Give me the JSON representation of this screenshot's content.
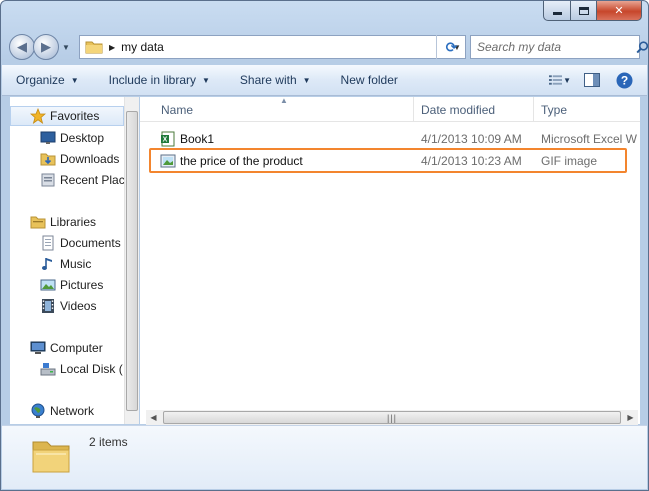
{
  "window": {
    "controls": {
      "minimize": "minimize-icon",
      "maximize": "maximize-icon",
      "close": "close-icon"
    }
  },
  "address": {
    "path": "my data",
    "search_placeholder": "Search my data"
  },
  "toolbar": {
    "organize": "Organize",
    "include_in_library": "Include in library",
    "share_with": "Share with",
    "new_folder": "New folder"
  },
  "nav": {
    "favorites": "Favorites",
    "desktop": "Desktop",
    "downloads": "Downloads",
    "recent_places": "Recent Plac",
    "libraries": "Libraries",
    "documents": "Documents",
    "music": "Music",
    "pictures": "Pictures",
    "videos": "Videos",
    "computer": "Computer",
    "local_disk": "Local Disk (",
    "network": "Network"
  },
  "columns": {
    "name": "Name",
    "date_modified": "Date modified",
    "type": "Type"
  },
  "files": [
    {
      "name": "Book1",
      "date": "4/1/2013 10:09 AM",
      "type": "Microsoft Excel W...",
      "icon": "excel-file-icon"
    },
    {
      "name": "the price of the product",
      "date": "4/1/2013 10:23 AM",
      "type": "GIF image",
      "icon": "gif-image-icon"
    }
  ],
  "details": {
    "item_count": "2 items"
  },
  "colors": {
    "highlight": "#f3852e",
    "toolbar_text": "#1e395b"
  }
}
